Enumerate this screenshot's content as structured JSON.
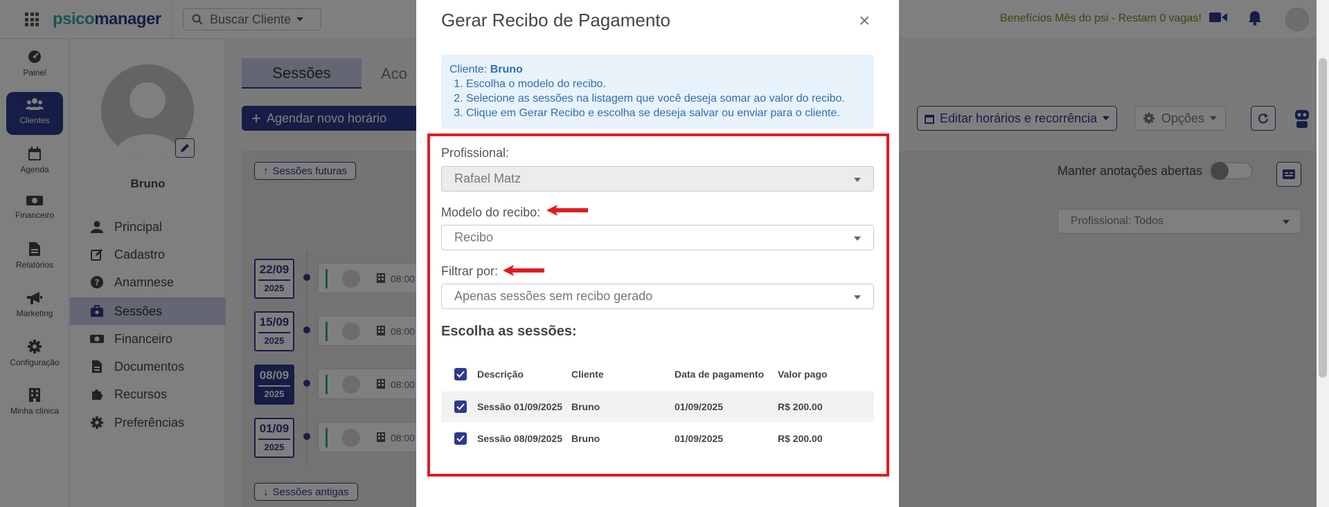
{
  "app": {
    "logo_part1": "psico",
    "logo_part2": "manager",
    "search_label": "Buscar Cliente",
    "benefit_text": "Benefícios Mês do psi - Restam 0 vagas!"
  },
  "nav": [
    {
      "label": "Painel",
      "icon": "dashboard-icon"
    },
    {
      "label": "Clientes",
      "icon": "users-icon"
    },
    {
      "label": "Agenda",
      "icon": "calendar-icon"
    },
    {
      "label": "Financeiro",
      "icon": "money-icon"
    },
    {
      "label": "Relatórios",
      "icon": "file-icon"
    },
    {
      "label": "Marketing",
      "icon": "megaphone-icon"
    },
    {
      "label": "Configuração",
      "icon": "gear-icon"
    },
    {
      "label": "Minha clínica",
      "icon": "building-icon"
    }
  ],
  "client": {
    "name": "Bruno",
    "menu": [
      {
        "label": "Principal",
        "icon": "user-icon"
      },
      {
        "label": "Cadastro",
        "icon": "edit-icon"
      },
      {
        "label": "Anamnese",
        "icon": "question-icon"
      },
      {
        "label": "Sessões",
        "icon": "briefcase-icon"
      },
      {
        "label": "Financeiro",
        "icon": "money-icon"
      },
      {
        "label": "Documentos",
        "icon": "file-icon"
      },
      {
        "label": "Recursos",
        "icon": "puzzle-icon"
      },
      {
        "label": "Preferências",
        "icon": "gear-icon"
      }
    ]
  },
  "main": {
    "tab_active": "Sessões",
    "tab_other": "Aco",
    "schedule_button": "Agendar novo horário",
    "future_sessions": "Sessões futuras",
    "past_sessions": "Sessões antigas",
    "edit_schedule": "Editar horários e recorrência",
    "options": "Opções",
    "keep_notes": "Manter anotações abertas",
    "professional_filter": "Profissional: Todos",
    "sessions": [
      {
        "day": "22/09",
        "year": "2025",
        "time": "08:00"
      },
      {
        "day": "15/09",
        "year": "2025",
        "time": "08:00"
      },
      {
        "day": "08/09",
        "year": "2025",
        "time": "08:00"
      },
      {
        "day": "01/09",
        "year": "2025",
        "time": "08:00"
      }
    ]
  },
  "modal": {
    "title": "Gerar Recibo de Pagamento",
    "close": "×",
    "info_client_label": "Cliente:",
    "info_client_name": "Bruno",
    "steps": [
      "Escolha o modelo do recibo.",
      "Selecione as sessões na listagem que você deseja somar ao valor do recibo.",
      "Clique em Gerar Recibo e escolha se deseja salvar ou enviar para o cliente."
    ],
    "professional_label": "Profissional:",
    "professional_value": "Rafael Matz",
    "model_label": "Modelo do recibo:",
    "model_value": "Recibo",
    "filter_label": "Filtrar por:",
    "filter_value": "Apenas sessões sem recibo gerado",
    "choose_label": "Escolha as sessões:",
    "columns": [
      "Descrição",
      "Cliente",
      "Data de pagamento",
      "Valor pago"
    ],
    "rows": [
      {
        "desc": "Sessão 01/09/2025",
        "client": "Bruno",
        "date": "01/09/2025",
        "value": "R$ 200.00",
        "checked": true
      },
      {
        "desc": "Sessão 08/09/2025",
        "client": "Bruno",
        "date": "01/09/2025",
        "value": "R$ 200.00",
        "checked": true
      }
    ]
  },
  "colors": {
    "primary": "#2d3a8c",
    "teal": "#2fa8a0",
    "highlight_red": "#e01b24"
  }
}
